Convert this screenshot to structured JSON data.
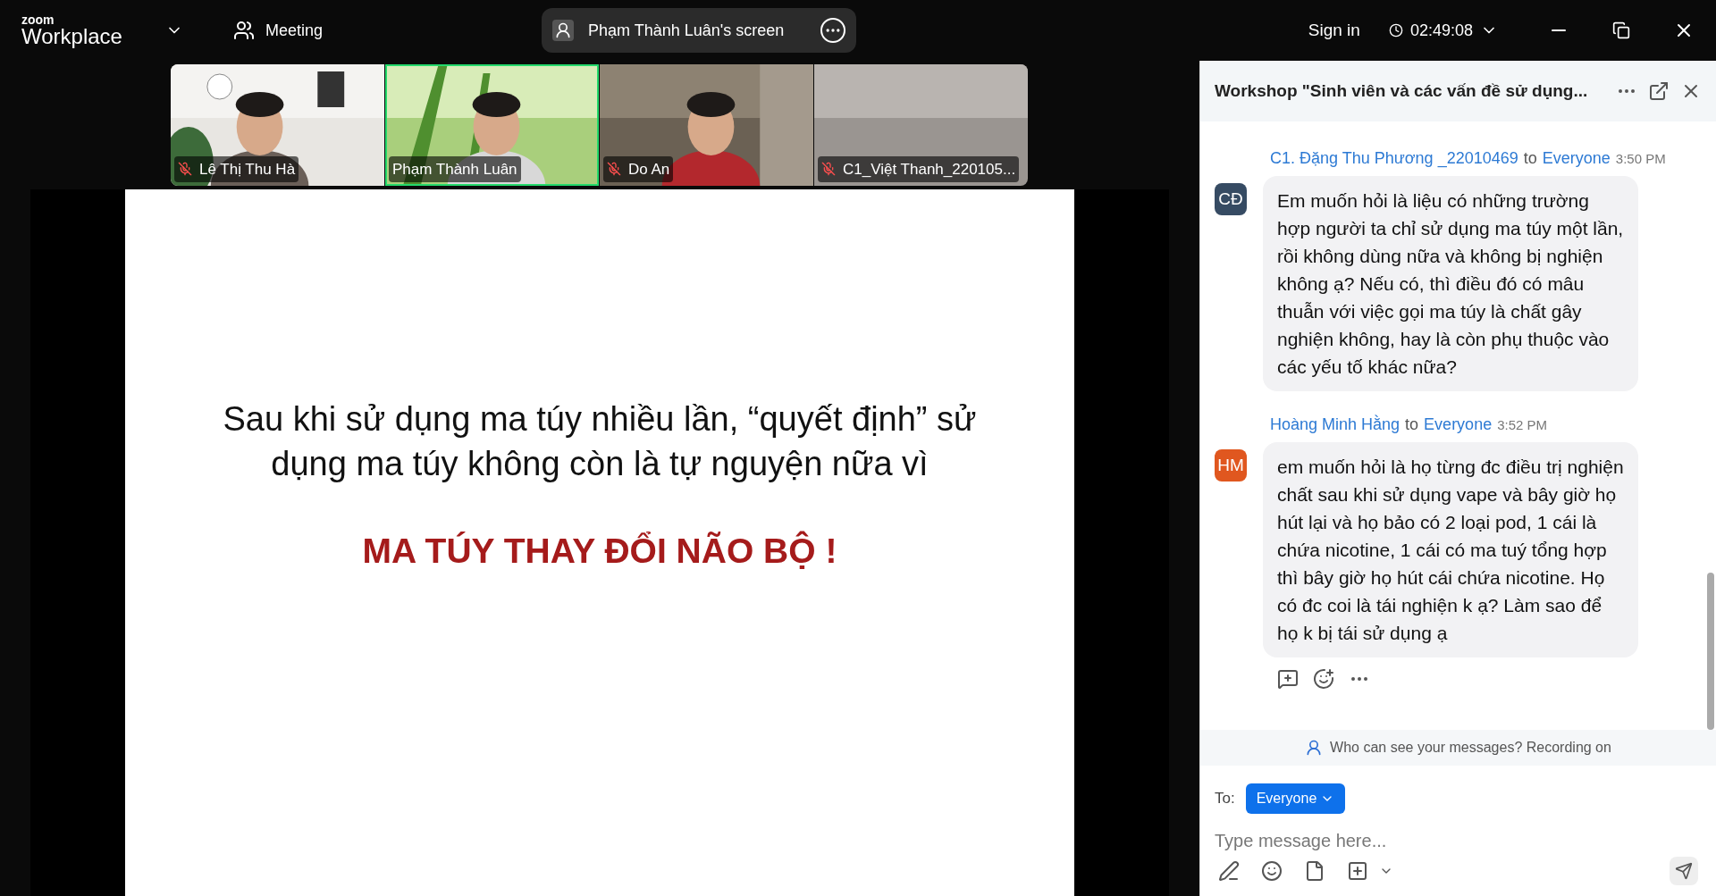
{
  "app": {
    "logo_top": "zoom",
    "logo_bottom": "Workplace",
    "meeting_label": "Meeting",
    "share_label": "Phạm Thành Luân's screen",
    "sign_in": "Sign in",
    "timer": "02:49:08"
  },
  "participants": [
    {
      "name": "Lê Thị Thu Hà",
      "muted": true,
      "selected": false
    },
    {
      "name": "Phạm Thành Luân",
      "muted": false,
      "selected": true
    },
    {
      "name": "Do An",
      "muted": true,
      "selected": false
    },
    {
      "name": "C1_Việt Thanh_220105...",
      "muted": true,
      "selected": false
    }
  ],
  "slide": {
    "text": "Sau khi sử dụng ma túy nhiều lần, “quyết định” sử dụng ma túy không còn là tự nguyện nữa vì",
    "headline": "MA TÚY THAY ĐỔI NÃO BỘ !"
  },
  "chat": {
    "title": "Workshop \"Sinh viên và các vấn đề sử dụng...",
    "messages": [
      {
        "initials": "CĐ",
        "color": "#364b63",
        "sender": "C1. Đặng Thu Phương _22010469",
        "to_word": "to",
        "recipient": "Everyone",
        "time": "3:50 PM",
        "text": "Em muốn hỏi là liệu có những trường hợp người ta chỉ sử dụng ma túy một lần, rồi không dùng nữa và không bị nghiện không ạ? Nếu có, thì điều đó có mâu thuẫn với việc gọi ma túy là chất gây nghiện không, hay là còn phụ thuộc vào các yếu tố khác nữa?"
      },
      {
        "initials": "HM",
        "color": "#e0571f",
        "sender": "Hoàng Minh Hằng",
        "to_word": "to",
        "recipient": "Everyone",
        "time": "3:52 PM",
        "text": "em muốn hỏi là họ từng đc điều trị nghiện chất sau khi sử dụng vape và bây giờ họ hút lại và họ bảo có 2 loại pod, 1 cái là chứa nicotine, 1 cái có ma tuý tổng hợp thì bây giờ họ hút cái chứa nicotine. Họ có đc coi là tái nghiện k ạ? Làm sao để họ k bị tái sử dụng ạ"
      }
    ],
    "notice": "Who can see your messages? Recording on",
    "to_label": "To:",
    "recipient_button": "Everyone",
    "placeholder": "Type message here..."
  }
}
